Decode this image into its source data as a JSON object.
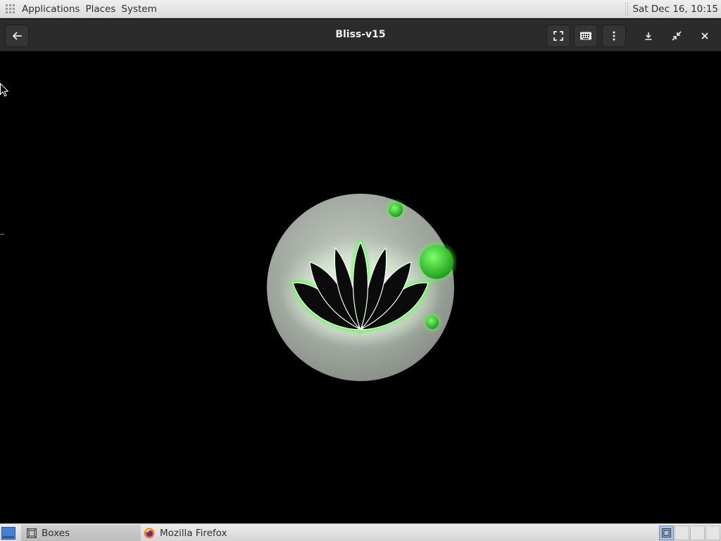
{
  "top_panel": {
    "menus": [
      "Applications",
      "Places",
      "System"
    ],
    "clock": "Sat Dec 16, 10:15"
  },
  "headerbar": {
    "title": "Bliss-v15",
    "buttons": [
      "back",
      "fullscreen",
      "keyboard",
      "menu",
      "download",
      "restore",
      "close"
    ]
  },
  "colors": {
    "logo_glow": "#5cff4a",
    "logo_disc": "#9aa29a",
    "headerbar_bg": "#2b2b2b"
  },
  "taskbar": {
    "tasks": [
      {
        "label": "Boxes",
        "icon": "boxes-icon",
        "active": true
      },
      {
        "label": "Mozilla Firefox",
        "icon": "firefox-icon",
        "active": false
      }
    ]
  }
}
